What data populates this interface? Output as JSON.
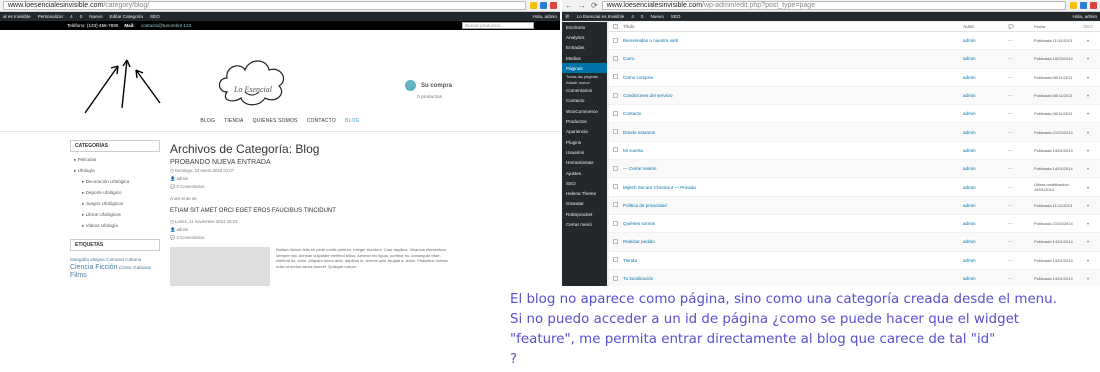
{
  "left": {
    "url": "www.loesencialesinvisible.com",
    "url_path": "/category/blog/",
    "admin_bar": [
      "al es Invisible",
      "Personalizar",
      "4",
      "0",
      "Nuevo",
      "Editar Categoría",
      "SEO"
    ],
    "admin_greeting": "Hola, admin",
    "phone": "Teléfono: (123) 456-7890",
    "mail_label": "Mail:",
    "mail": "contacto@tunombre.123",
    "search_placeholder": "Buscar productos...",
    "logo_text": "Lo Esencial",
    "cart_title": "Su compra",
    "cart_items": "0 productos",
    "menu": [
      "BLOG",
      "TIENDA",
      "QUIÉNES SOMOS",
      "CONTACTO",
      "BLOG"
    ],
    "sidebar_title": "CATEGORÍAS",
    "categories": [
      "Películas",
      "Ufología"
    ],
    "subcategories": [
      "Decoración Ufológica",
      "Deporte ufológico",
      "Juegos Ufológicos",
      "Libros Ufológicos",
      "Videos Ufología"
    ],
    "tags_title": "ETIQUETAS",
    "tags_line1": "Mangafia alsigna Carranat Cabana",
    "tags_line2": "Ciencia Ficción",
    "tags_line3": "Cómic Galáxias",
    "tags_line4": "Films",
    "archive_title": "Archivos de Categoría: Blog",
    "post1_title": "PROBANDO NUEVA ENTRADA",
    "post1_date": "Domingo, 24 enero 2016 01:07",
    "post1_author": "admin",
    "post1_comments": "0 Comentarios",
    "read_more": "A ver si se ve",
    "post2_title": "ETIAM SIT AMET ORCI EGET EROS FAUCIBUS TINCIDUNT",
    "post2_date": "Lunes, 11 noviembre 2013 16:24",
    "post2_author": "admin",
    "post2_comments": "3 Comentarios",
    "post2_excerpt": "Nullam dictum felis eu pede mollis pretium. Integer tincidunt. Cras dapibus. Vivamus elementum semper nisi. Aenean vulputate eleifend tellus. Aenean leo ligula, porttitor eu, consequat vitae, eleifend ac, enim. Aliquam lorem ante, dapibus in, viverra quis, feugiat a, tellus. Phasellus viverra nulla ut metus varius laoreet. Quisque rutrum."
  },
  "right": {
    "url": "www.loesencialesinvisible.com",
    "url_path": "/wp-admin/edit.php?post_type=page",
    "admin_bar": [
      "Lo Esencial es Invisible",
      "4",
      "0",
      "Nuevo",
      "SEO"
    ],
    "admin_greeting": "Hola, admin",
    "sidebar": [
      "Escritorio",
      "Analytics",
      "Entradas",
      "Medios",
      "Páginas",
      "Todas las páginas",
      "Añadir nueva",
      "Comentarios",
      "Contacto",
      "WooCommerce",
      "Productos",
      "Apariencia",
      "Plugins",
      "Usuarios",
      "Herramientas",
      "Ajustes",
      "SEO",
      "Helena Theme",
      "Gravatar",
      "RokSprocket",
      "Cerrar menú"
    ],
    "columns": [
      "Título",
      "Autor",
      "Fecha",
      "SEO"
    ],
    "rows": [
      {
        "title": "Bienvenidos a nuestra web",
        "author": "admin",
        "date": "Publicada 11/11/2013"
      },
      {
        "title": "Carro",
        "author": "admin",
        "date": "Publicada 18/03/2014"
      },
      {
        "title": "Cómo comprar",
        "author": "admin",
        "date": "Publicada 08/11/2013"
      },
      {
        "title": "Condiciones del servicio",
        "author": "admin",
        "date": "Publicada 08/11/2013"
      },
      {
        "title": "Contacto",
        "author": "admin",
        "date": "Publicada 08/11/2013"
      },
      {
        "title": "Dónde estamos",
        "author": "admin",
        "date": "Publicada 21/03/2014"
      },
      {
        "title": "Mi cuenta",
        "author": "admin",
        "date": "Publicada 14/01/2014"
      },
      {
        "title": "— Cerrar sesión",
        "author": "admin",
        "date": "Publicada 14/01/2014"
      },
      {
        "title": "Mijireh Secure Checkout — Privada",
        "author": "admin",
        "date": "Última modificación 14/01/2014"
      },
      {
        "title": "Política de privacidad",
        "author": "admin",
        "date": "Publicada 11/11/2013"
      },
      {
        "title": "Quiénes somos",
        "author": "admin",
        "date": "Publicada 21/03/2014"
      },
      {
        "title": "Realizar pedido",
        "author": "admin",
        "date": "Publicada 14/01/2014"
      },
      {
        "title": "Tienda",
        "author": "admin",
        "date": "Publicada 14/01/2014"
      },
      {
        "title": "Tu localización",
        "author": "admin",
        "date": "Publicada 14/01/2014"
      }
    ],
    "dash": "—"
  },
  "question": {
    "line1": "El blog no aparece como página, sino como una categoría creada desde el menu.",
    "line2": "Si no puedo acceder a un id de página ¿como se puede hacer que el widget",
    "line3": "\"feature\", me permita entrar directamente al blog que carece de tal \"id\"",
    "line4": "?"
  },
  "colors": {
    "wp_dark": "#23282d",
    "wp_blue": "#0073aa",
    "accent": "#3aa0c0",
    "question": "#5a4fcf"
  }
}
